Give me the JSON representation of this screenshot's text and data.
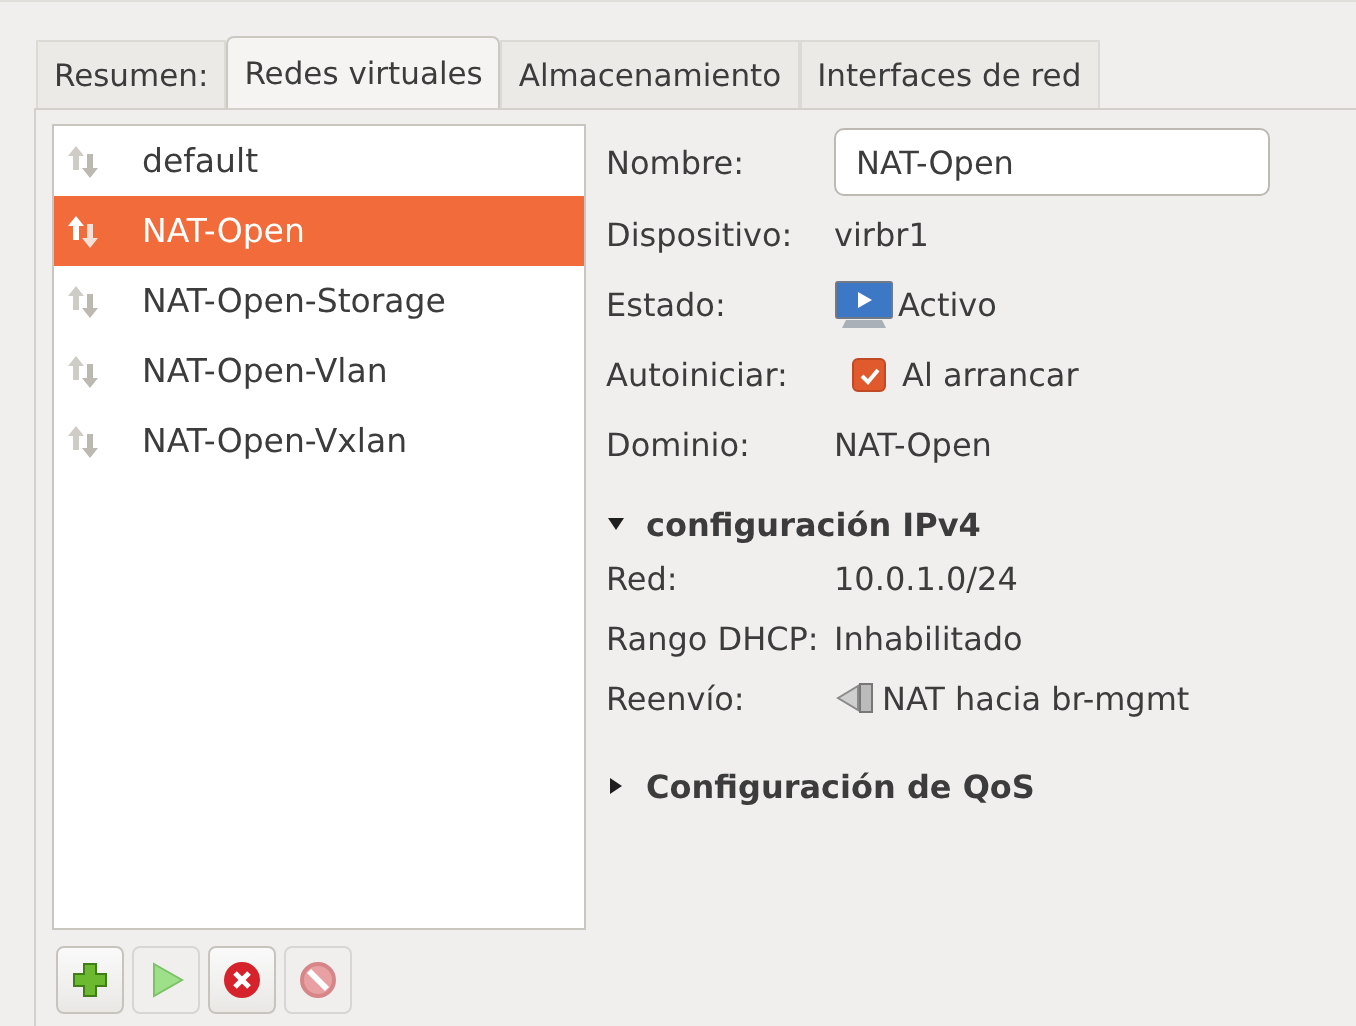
{
  "tabs": [
    {
      "label": "Resumen:",
      "selected": false
    },
    {
      "label": "Redes virtuales",
      "selected": true
    },
    {
      "label": "Almacenamiento",
      "selected": false
    },
    {
      "label": "Interfaces de red",
      "selected": false
    }
  ],
  "networks": [
    {
      "name": "default",
      "selected": false
    },
    {
      "name": "NAT-Open",
      "selected": true
    },
    {
      "name": "NAT-Open-Storage",
      "selected": false
    },
    {
      "name": "NAT-Open-Vlan",
      "selected": false
    },
    {
      "name": "NAT-Open-Vxlan",
      "selected": false
    }
  ],
  "toolbar": [
    {
      "kind": "add",
      "disabled": false
    },
    {
      "kind": "start",
      "disabled": true
    },
    {
      "kind": "delete",
      "disabled": false
    },
    {
      "kind": "stop",
      "disabled": true
    }
  ],
  "details": {
    "name_label": "Nombre:",
    "name_value": "NAT-Open",
    "device_label": "Dispositivo:",
    "device_value": "virbr1",
    "state_label": "Estado:",
    "state_value": "Activo",
    "autostart_label": "Autoiniciar:",
    "autostart_text": "Al arrancar",
    "autostart_checked": true,
    "domain_label": "Dominio:",
    "domain_value": "NAT-Open"
  },
  "ipv4": {
    "title": "configuración IPv4",
    "expanded": true,
    "rows": [
      {
        "kind": "text",
        "label": "Red:",
        "value": "10.0.1.0/24"
      },
      {
        "kind": "text",
        "label": "Rango DHCP:",
        "value": "Inhabilitado"
      },
      {
        "kind": "forward",
        "label": "Reenvío:",
        "value": "NAT hacia br-mgmt"
      }
    ]
  },
  "qos": {
    "title": "Configuración de QoS",
    "expanded": false
  }
}
